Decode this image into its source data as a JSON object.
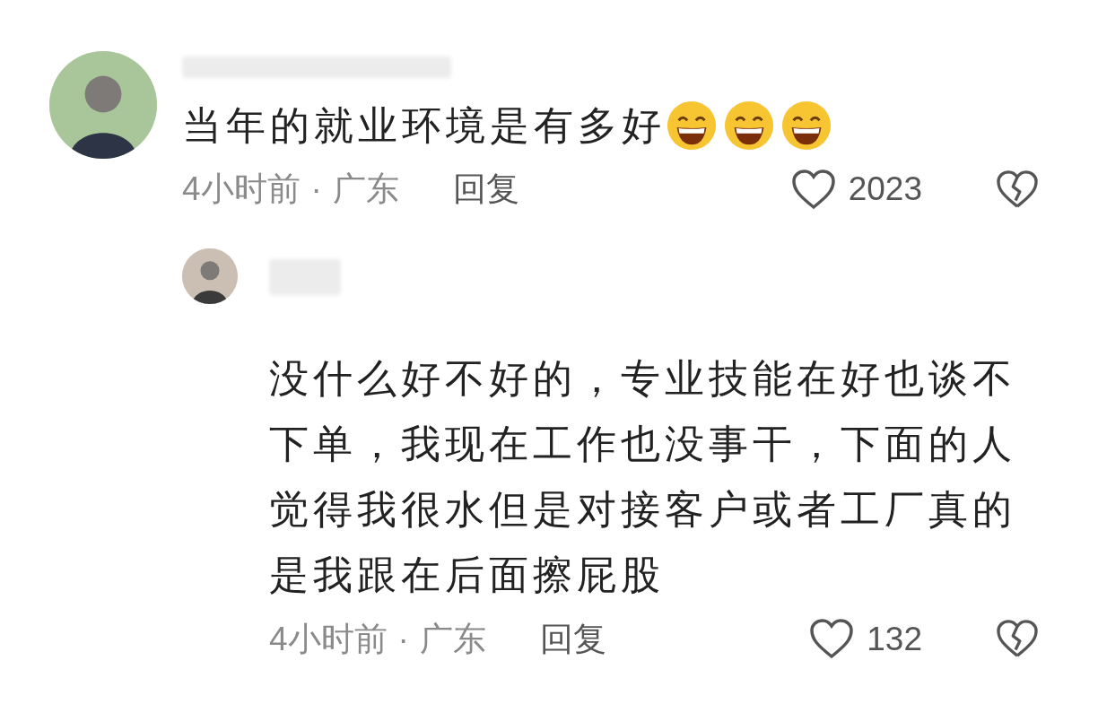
{
  "comments": [
    {
      "kind": "comment",
      "text": "当年的就业环境是有多好",
      "emojis": [
        {
          "kind": "grin"
        },
        {
          "kind": "grin"
        },
        {
          "kind": "grin"
        }
      ],
      "time": "4小时前",
      "separator": "·",
      "location": "广东",
      "reply_label": "回复",
      "likes": "2023",
      "liked": false,
      "disliked": false
    },
    {
      "kind": "reply",
      "text": "没什么好不好的，专业技能在好也谈不下单，我现在工作也没事干，下面的人觉得我很水但是对接客户或者工厂真的是我跟在后面擦屁股",
      "time": "4小时前",
      "separator": "·",
      "location": "广东",
      "reply_label": "回复",
      "likes": "132",
      "liked": false,
      "disliked": false
    }
  ]
}
